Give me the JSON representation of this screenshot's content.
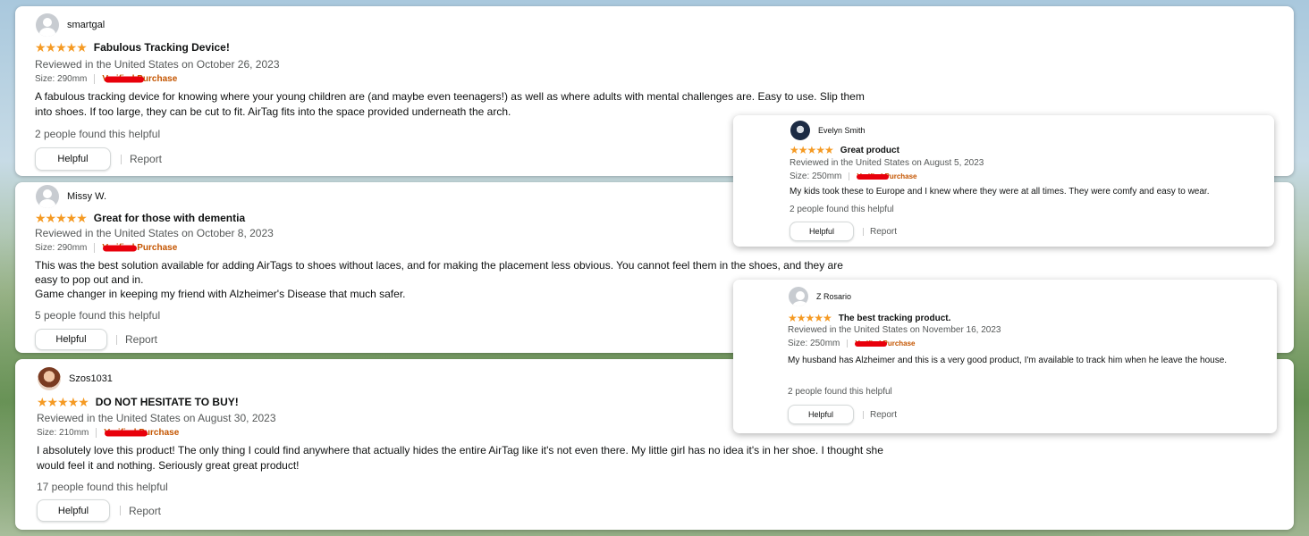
{
  "reviews": [
    {
      "name": "smartgal",
      "stars": "★★★★★",
      "title": "Fabulous Tracking Device!",
      "meta": "Reviewed in the United States on October 26, 2023",
      "size": "Size: 290mm",
      "verified": "Verified Purchase",
      "body": "A fabulous tracking device for knowing where your young children are (and maybe even teenagers!) as well as where adults with mental challenges are. Easy to use. Slip them into shoes. If too large, they can be cut to fit. AirTag fits into the space provided underneath the arch.",
      "helpful_count": "2 people found this helpful",
      "helpful_label": "Helpful",
      "report_label": "Report"
    },
    {
      "name": "Missy W.",
      "stars": "★★★★★",
      "title": "Great for those with dementia",
      "meta": "Reviewed in the United States on October 8, 2023",
      "size": "Size: 290mm",
      "verified": "Verified Purchase",
      "body1": "This was the best solution available for adding AirTags to shoes without laces, and for making the placement less obvious. You cannot feel them in the shoes, and they are easy to pop out and in.",
      "body2": "Game changer in keeping my friend with Alzheimer's Disease that much safer.",
      "helpful_count": "5 people found this helpful",
      "helpful_label": "Helpful",
      "report_label": "Report"
    },
    {
      "name": "Szos1031",
      "stars": "★★★★★",
      "title": "DO NOT HESITATE TO BUY!",
      "meta": "Reviewed in the United States on August 30, 2023",
      "size": "Size: 210mm",
      "verified": "Verified Purchase",
      "body": "I absolutely love this product! The only thing I could find anywhere that actually hides the entire AirTag like it's not even there. My little girl has no idea it's in her shoe. I thought she would feel it and nothing. Seriously great great product!",
      "helpful_count": "17 people found this helpful",
      "helpful_label": "Helpful",
      "report_label": "Report"
    },
    {
      "name": "Evelyn Smith",
      "stars": "★★★★★",
      "title": "Great product",
      "meta": "Reviewed in the United States on August 5, 2023",
      "size": "Size: 250mm",
      "verified": "Verified Purchase",
      "body": "My kids took these to Europe and I knew where they were at all times. They were comfy and easy to wear.",
      "helpful_count": "2 people found this helpful",
      "helpful_label": "Helpful",
      "report_label": "Report"
    },
    {
      "name": "Z Rosario",
      "stars": "★★★★★",
      "title": "The best tracking product.",
      "meta": "Reviewed in the United States on November 16, 2023",
      "size": "Size: 250mm",
      "verified": "Verified Purchase",
      "body": "My husband has Alzheimer and this is a very good product, I'm available to track him when he leave the house.",
      "helpful_count": "2 people found this helpful",
      "helpful_label": "Helpful",
      "report_label": "Report"
    }
  ],
  "colors": {
    "star": "#f59a23",
    "verified": "#c45500",
    "redaction": "#e8000b"
  },
  "icons": {
    "avatar_default": "user-silhouette-icon",
    "star": "star-icon"
  }
}
